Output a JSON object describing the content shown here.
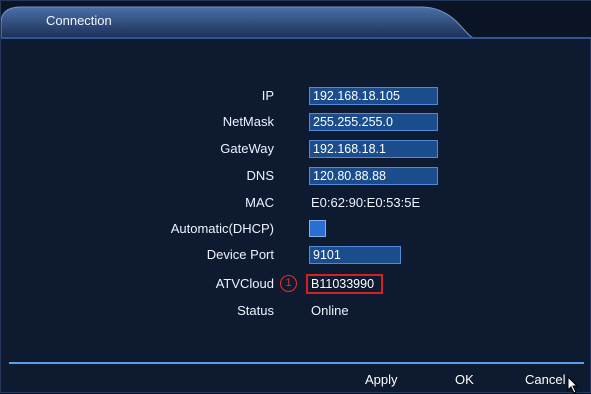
{
  "window": {
    "title": "Connection"
  },
  "fields": {
    "ip": {
      "label": "IP",
      "value": "192.168.18.105"
    },
    "netmask": {
      "label": "NetMask",
      "value": "255.255.255.0"
    },
    "gateway": {
      "label": "GateWay",
      "value": "192.168.18.1"
    },
    "dns": {
      "label": "DNS",
      "value": "120.80.88.88"
    },
    "mac": {
      "label": "MAC",
      "value": "E0:62:90:E0:53:5E"
    },
    "dhcp": {
      "label": "Automatic(DHCP)",
      "checked": false
    },
    "device_port": {
      "label": "Device Port",
      "value": "9101"
    },
    "atvcloud": {
      "label": "ATVCloud",
      "value": "B11033990",
      "annotation": "1"
    },
    "status": {
      "label": "Status",
      "value": "Online"
    }
  },
  "buttons": {
    "apply": "Apply",
    "ok": "OK",
    "cancel": "Cancel"
  },
  "colors": {
    "background": "#0e1a30",
    "field_fill": "#1b4c8c",
    "field_border": "#4f8ad8",
    "highlight_red": "#d42124",
    "accent_line": "#5aa0e8"
  },
  "icons": {
    "cursor": "arrow-cursor-icon"
  }
}
